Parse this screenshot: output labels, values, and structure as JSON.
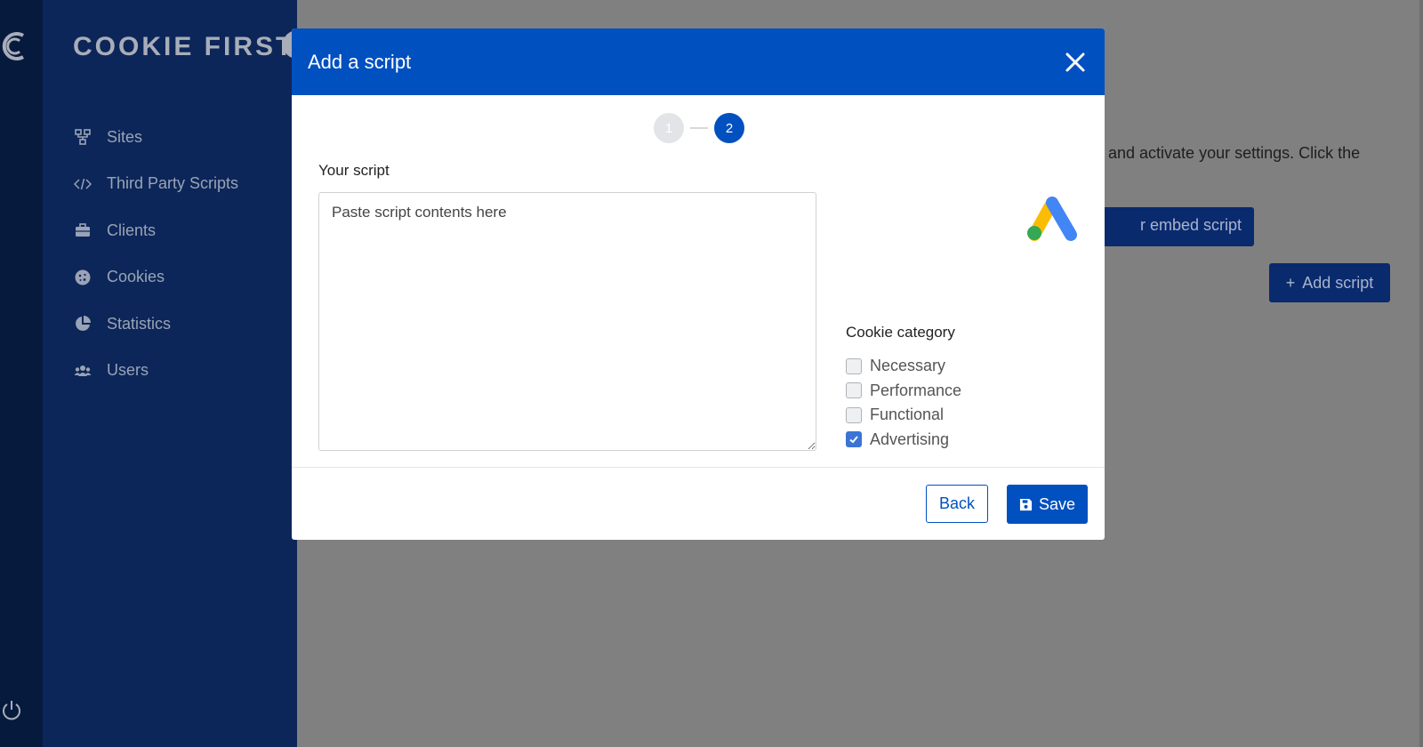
{
  "app": {
    "brand": "COOKIE FIRST"
  },
  "sidebar": {
    "items": [
      {
        "label": "Sites",
        "icon": "sitemap-icon"
      },
      {
        "label": "Third Party Scripts",
        "icon": "code-icon"
      },
      {
        "label": "Clients",
        "icon": "briefcase-icon"
      },
      {
        "label": "Cookies",
        "icon": "cookie-icon"
      },
      {
        "label": "Statistics",
        "icon": "pie-chart-icon"
      },
      {
        "label": "Users",
        "icon": "users-icon"
      }
    ]
  },
  "background": {
    "instruction_text": "and activate your settings. Click the",
    "embed_button": "r embed script",
    "add_script_button": "Add script"
  },
  "modal": {
    "title": "Add a script",
    "steps": [
      "1",
      "2"
    ],
    "active_step": 2,
    "script_label": "Your script",
    "script_placeholder": "Paste script contents here",
    "script_value": "",
    "cookie_category_label": "Cookie category",
    "categories": [
      {
        "label": "Necessary",
        "checked": false
      },
      {
        "label": "Performance",
        "checked": false
      },
      {
        "label": "Functional",
        "checked": false
      },
      {
        "label": "Advertising",
        "checked": true
      }
    ],
    "back_button": "Back",
    "save_button": "Save"
  },
  "colors": {
    "primary": "#0050c0",
    "sidebar": "#0c2659",
    "rail": "#061a3e",
    "overlay": "#808080"
  }
}
